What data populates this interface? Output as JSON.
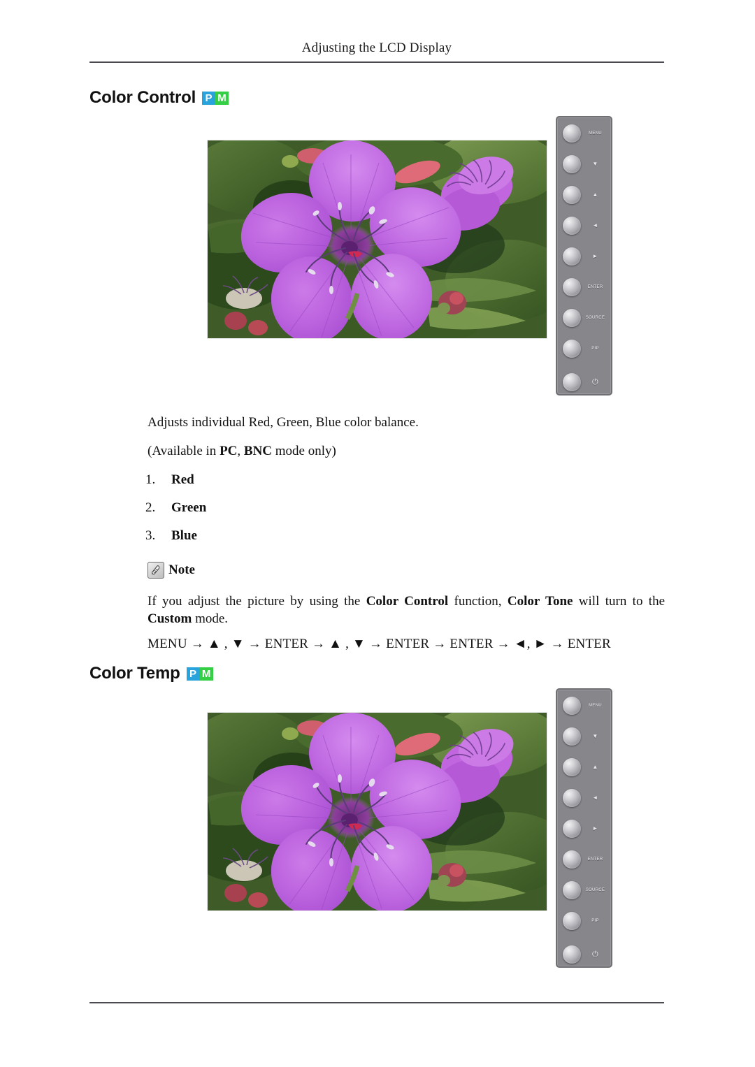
{
  "header": {
    "title": "Adjusting the LCD Display"
  },
  "badges": {
    "p": "P",
    "m": "M",
    "p_color": "#29a3dc",
    "m_color": "#34cf45"
  },
  "sections": [
    {
      "id": "color-control",
      "heading": "Color Control"
    },
    {
      "id": "color-temp",
      "heading": "Color Temp"
    }
  ],
  "illustration": {
    "alt": "LCD monitor showing a purple Tibouchina flower with side control panel",
    "panel_buttons": [
      {
        "name": "menu",
        "label": "MENU"
      },
      {
        "name": "down",
        "label": "▼"
      },
      {
        "name": "up",
        "label": "▲"
      },
      {
        "name": "left",
        "label": "◄"
      },
      {
        "name": "right",
        "label": "►"
      },
      {
        "name": "enter",
        "label": "ENTER"
      },
      {
        "name": "source",
        "label": "SOURCE"
      },
      {
        "name": "pip",
        "label": "PIP"
      },
      {
        "name": "power",
        "label": "⏻"
      }
    ]
  },
  "body": {
    "adjusts": "Adjusts individual Red, Green, Blue color balance.",
    "available_prefix": "(Available in ",
    "available_mode_pc": "PC",
    "available_sep": ", ",
    "available_mode_bnc": "BNC",
    "available_suffix": " mode only)",
    "list": [
      {
        "num": "1.",
        "label": "Red"
      },
      {
        "num": "2.",
        "label": "Green"
      },
      {
        "num": "3.",
        "label": "Blue"
      }
    ]
  },
  "note": {
    "label": "Note",
    "text_1": "If you adjust the picture by using the ",
    "bold_1": "Color Control",
    "text_2": " function, ",
    "bold_2": "Color Tone",
    "text_3": " will turn to the ",
    "bold_3": "Custom",
    "text_4": " mode.",
    "menu_path": "MENU → ▲ , ▼ → ENTER → ▲ , ▼ → ENTER → ENTER → ◄, ► → ENTER"
  }
}
